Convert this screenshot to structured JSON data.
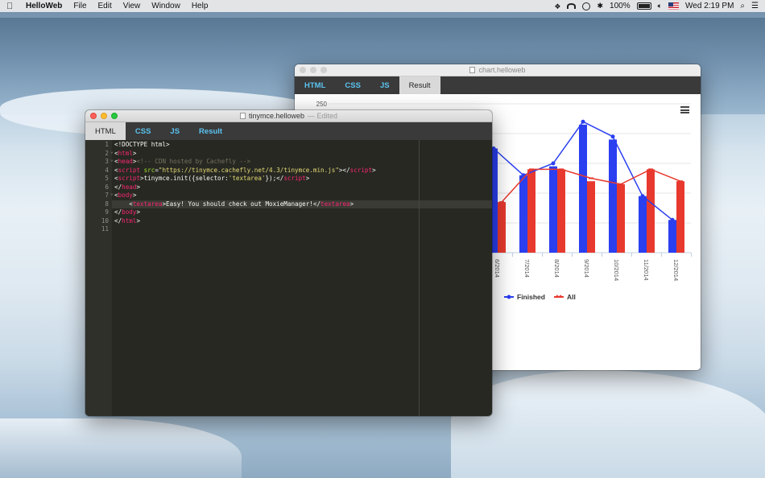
{
  "menubar": {
    "app_name": "HelloWeb",
    "menus": [
      "File",
      "Edit",
      "View",
      "Window",
      "Help"
    ],
    "battery": "100%",
    "clock": "Wed 2:19 PM"
  },
  "chart_window": {
    "title": "chart.helloweb",
    "tabs": [
      "HTML",
      "CSS",
      "JS",
      "Result"
    ],
    "active_tab": "Result"
  },
  "editor_window": {
    "title": "tinymce.helloweb",
    "status": "Edited",
    "tabs": [
      "HTML",
      "CSS",
      "JS",
      "Result"
    ],
    "active_tab": "HTML",
    "current_line": 8,
    "lines": [
      {
        "n": "1",
        "fold": false,
        "tokens": [
          {
            "t": "txt",
            "v": "<!DOCTYPE html>"
          }
        ]
      },
      {
        "n": "2",
        "fold": true,
        "tokens": [
          {
            "t": "txt",
            "v": "<"
          },
          {
            "t": "tag",
            "v": "html"
          },
          {
            "t": "txt",
            "v": ">"
          }
        ]
      },
      {
        "n": "3",
        "fold": true,
        "tokens": [
          {
            "t": "txt",
            "v": "<"
          },
          {
            "t": "tag",
            "v": "head"
          },
          {
            "t": "txt",
            "v": ">"
          },
          {
            "t": "cmt",
            "v": "<!-- CDN hosted by Cachefly -->"
          }
        ]
      },
      {
        "n": "4",
        "fold": false,
        "tokens": [
          {
            "t": "txt",
            "v": "<"
          },
          {
            "t": "tag",
            "v": "script"
          },
          {
            "t": "txt",
            "v": " "
          },
          {
            "t": "attr",
            "v": "src"
          },
          {
            "t": "txt",
            "v": "="
          },
          {
            "t": "str",
            "v": "\"https://tinymce.cachefly.net/4.3/tinymce.min.js\""
          },
          {
            "t": "txt",
            "v": "></"
          },
          {
            "t": "tag",
            "v": "script"
          },
          {
            "t": "txt",
            "v": ">"
          }
        ]
      },
      {
        "n": "5",
        "fold": false,
        "tokens": [
          {
            "t": "txt",
            "v": "<"
          },
          {
            "t": "tag",
            "v": "script"
          },
          {
            "t": "txt",
            "v": ">tinymce.init({selector:"
          },
          {
            "t": "str",
            "v": "'textarea'"
          },
          {
            "t": "txt",
            "v": "});</"
          },
          {
            "t": "tag",
            "v": "script"
          },
          {
            "t": "txt",
            "v": ">"
          }
        ]
      },
      {
        "n": "6",
        "fold": false,
        "tokens": [
          {
            "t": "txt",
            "v": "</"
          },
          {
            "t": "tag",
            "v": "head"
          },
          {
            "t": "txt",
            "v": ">"
          }
        ]
      },
      {
        "n": "7",
        "fold": true,
        "tokens": [
          {
            "t": "txt",
            "v": "<"
          },
          {
            "t": "tag",
            "v": "body"
          },
          {
            "t": "txt",
            "v": ">"
          }
        ]
      },
      {
        "n": "8",
        "fold": false,
        "tokens": [
          {
            "t": "txt",
            "v": "    <"
          },
          {
            "t": "tag",
            "v": "textarea"
          },
          {
            "t": "txt",
            "v": ">Easy! You should check out MoxieManager!</"
          },
          {
            "t": "tag",
            "v": "textarea"
          },
          {
            "t": "txt",
            "v": ">"
          }
        ]
      },
      {
        "n": "9",
        "fold": false,
        "tokens": [
          {
            "t": "txt",
            "v": "</"
          },
          {
            "t": "tag",
            "v": "body"
          },
          {
            "t": "txt",
            "v": ">"
          }
        ]
      },
      {
        "n": "10",
        "fold": false,
        "tokens": [
          {
            "t": "txt",
            "v": "</"
          },
          {
            "t": "tag",
            "v": "html"
          },
          {
            "t": "txt",
            "v": ">"
          }
        ]
      },
      {
        "n": "11",
        "fold": false,
        "tokens": []
      }
    ]
  },
  "colors": {
    "finished": "#2a3ff0",
    "all": "#e8392e"
  },
  "chart_data": {
    "type": "bar",
    "ylim": [
      0,
      250
    ],
    "y_tick_labels_visible": [
      "250"
    ],
    "categories": [
      "6/2014",
      "7/2014",
      "8/2014",
      "9/2014",
      "10/2014",
      "11/2014",
      "12/2014"
    ],
    "series": [
      {
        "name": "Finished",
        "values": [
          175,
          130,
          145,
          215,
          190,
          95,
          55
        ],
        "line_values": [
          175,
          130,
          150,
          220,
          195,
          95,
          55
        ]
      },
      {
        "name": "All",
        "values": [
          85,
          140,
          140,
          120,
          115,
          140,
          120
        ],
        "line_values": [
          85,
          140,
          140,
          125,
          115,
          140,
          120
        ]
      }
    ],
    "grid": true,
    "legend_position": "bottom"
  }
}
